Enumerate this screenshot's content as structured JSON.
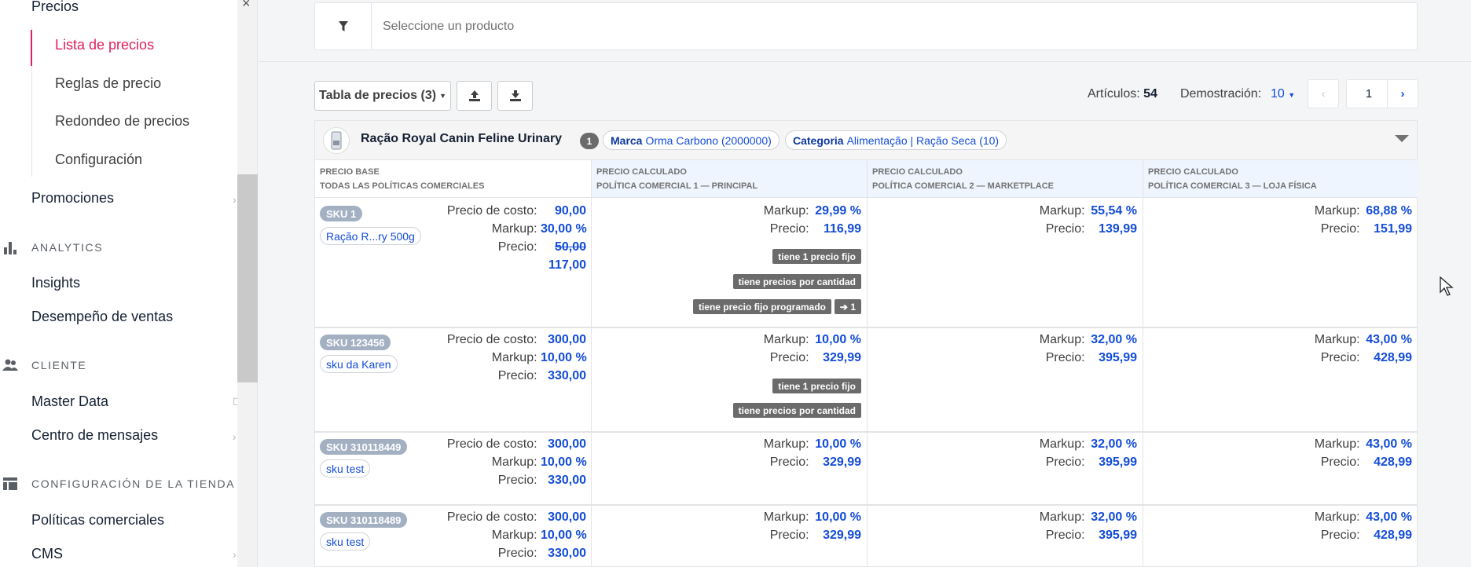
{
  "sidebar": {
    "pricing_title": "Precios",
    "sub_items": [
      {
        "label": "Lista de precios",
        "active": true
      },
      {
        "label": "Reglas de precio"
      },
      {
        "label": "Redondeo de precios"
      },
      {
        "label": "Configuración"
      }
    ],
    "promotions": "Promociones",
    "sections": {
      "analytics": {
        "label": "ANALYTICS",
        "icon": "bar-chart-icon",
        "items": [
          "Insights",
          "Desempeño de ventas"
        ]
      },
      "customer": {
        "label": "CLIENTE",
        "icon": "users-icon",
        "items": [
          "Master Data",
          "Centro de mensajes"
        ]
      },
      "store": {
        "label": "CONFIGURACIÓN DE LA TIENDA",
        "icon": "layout-icon",
        "items": [
          "Políticas comerciales",
          "CMS"
        ]
      }
    }
  },
  "filter": {
    "placeholder": "Seleccione un producto",
    "icon": "filter-icon"
  },
  "toolbar": {
    "price_table": "Tabla de precios (3)",
    "upload_icon": "upload-icon",
    "download_icon": "download-icon",
    "articles_label": "Artículos:",
    "articles_value": "54",
    "demo_label": "Demostración:",
    "demo_value": "10",
    "page": "1"
  },
  "product": {
    "name": "Ração Royal Canin Feline Urinary",
    "count": "1",
    "brand_label": "Marca",
    "brand_value": "Orma Carbono (2000000)",
    "category_label": "Categoria",
    "category_value": "Alimentação | Ração Seca (10)"
  },
  "columns": [
    {
      "line1": "PRECIO BASE",
      "line2": "TODAS LAS POLÍTICAS COMERCIALES"
    },
    {
      "line1": "PRECIO CALCULADO",
      "line2": "POLÍTICA COMERCIAL 1 — PRINCIPAL"
    },
    {
      "line1": "PRECIO CALCULADO",
      "line2": "POLÍTICA COMERCIAL 2 — MARKETPLACE"
    },
    {
      "line1": "PRECIO CALCULADO",
      "line2": "POLÍTICA COMERCIAL 3 — LOJA FÍSICA"
    }
  ],
  "labels": {
    "cost": "Precio de costo:",
    "markup": "Markup:",
    "price": "Precio:"
  },
  "rows": [
    {
      "sku": "SKU 1",
      "name": "Ração R...ry 500g",
      "cost": "90,00",
      "markup": "30,00 %",
      "price_old": "50,00",
      "price": "117,00",
      "p1": {
        "markup": "29,99 %",
        "price": "116,99",
        "flags": [
          "tiene 1 precio fijo",
          "tiene precios por cantidad",
          "tiene precio fijo programado"
        ],
        "scheduled": "1"
      },
      "p2": {
        "markup": "55,54 %",
        "price": "139,99"
      },
      "p3": {
        "markup": "68,88 %",
        "price": "151,99"
      }
    },
    {
      "sku": "SKU 123456",
      "name": "sku da Karen",
      "cost": "300,00",
      "markup": "10,00 %",
      "price": "330,00",
      "p1": {
        "markup": "10,00 %",
        "price": "329,99",
        "flags": [
          "tiene 1 precio fijo",
          "tiene precios por cantidad"
        ]
      },
      "p2": {
        "markup": "32,00 %",
        "price": "395,99"
      },
      "p3": {
        "markup": "43,00 %",
        "price": "428,99"
      }
    },
    {
      "sku": "SKU 310118449",
      "name": "sku test",
      "cost": "300,00",
      "markup": "10,00 %",
      "price": "330,00",
      "p1": {
        "markup": "10,00 %",
        "price": "329,99"
      },
      "p2": {
        "markup": "32,00 %",
        "price": "395,99"
      },
      "p3": {
        "markup": "43,00 %",
        "price": "428,99"
      }
    },
    {
      "sku": "SKU 310118489",
      "name": "sku test",
      "cost": "300,00",
      "markup": "10,00 %",
      "price": "330,00",
      "p1": {
        "markup": "10,00 %",
        "price": "329,99"
      },
      "p2": {
        "markup": "32,00 %",
        "price": "395,99"
      },
      "p3": {
        "markup": "43,00 %",
        "price": "428,99"
      }
    }
  ],
  "colors": {
    "accent": "#e11f5c",
    "link": "#134cd8",
    "badge": "#6b6b6b"
  }
}
